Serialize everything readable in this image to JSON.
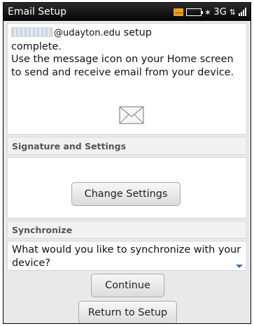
{
  "statusbar": {
    "title": "Email Setup",
    "network": "3G",
    "signal_bars": 4
  },
  "message": {
    "email_domain": "@udayton.edu",
    "line1_suffix": "setup",
    "line2": "complete.",
    "body": "Use the message icon on your Home screen to send and receive email from your device."
  },
  "signature": {
    "heading": "Signature and Settings",
    "button_label": "Change Settings"
  },
  "synchronize": {
    "heading": "Synchronize",
    "question": "What would you like to synchronize with your device?"
  },
  "actions": {
    "continue_label": "Continue",
    "return_label": "Return to Setup"
  },
  "colors": {
    "accent": "#2f6fc4",
    "statusbar": "#050505",
    "message_icon": "#e8a21c"
  }
}
